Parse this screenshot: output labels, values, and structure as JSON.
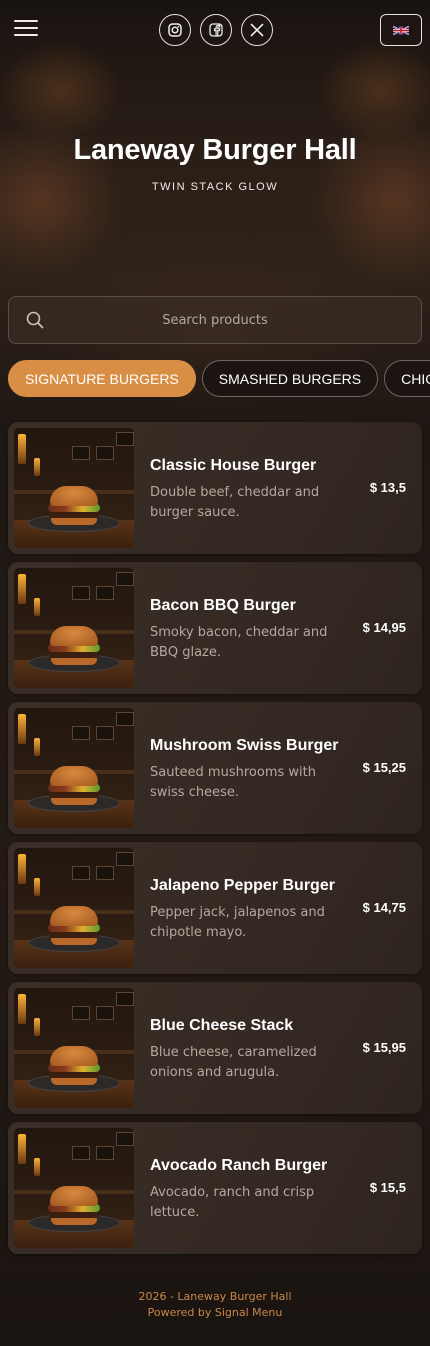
{
  "header": {
    "menu_icon": "hamburger-icon",
    "socials": [
      {
        "name": "instagram",
        "icon": "instagram-icon"
      },
      {
        "name": "facebook",
        "icon": "facebook-icon"
      },
      {
        "name": "x",
        "icon": "x-icon"
      }
    ],
    "language_icon": "uk-flag-icon"
  },
  "hero": {
    "title": "Laneway Burger Hall",
    "subtitle": "TWIN STACK GLOW"
  },
  "search": {
    "placeholder": "Search products",
    "value": ""
  },
  "categories": [
    {
      "label": "SIGNATURE BURGERS",
      "active": true
    },
    {
      "label": "SMASHED BURGERS",
      "active": false
    },
    {
      "label": "CHICKEN",
      "active": false
    }
  ],
  "items": [
    {
      "name": "Classic House Burger",
      "description": "Double beef, cheddar and burger sauce.",
      "price": "$ 13,5"
    },
    {
      "name": "Bacon BBQ Burger",
      "description": "Smoky bacon, cheddar and BBQ glaze.",
      "price": "$ 14,95"
    },
    {
      "name": "Mushroom Swiss Burger",
      "description": "Sauteed mushrooms with swiss cheese.",
      "price": "$ 15,25"
    },
    {
      "name": "Jalapeno Pepper Burger",
      "description": "Pepper jack, jalapenos and chipotle mayo.",
      "price": "$ 14,75"
    },
    {
      "name": "Blue Cheese Stack",
      "description": "Blue cheese, caramelized onions and arugula.",
      "price": "$ 15,95"
    },
    {
      "name": "Avocado Ranch Burger",
      "description": "Avocado, ranch and crisp lettuce.",
      "price": "$ 15,5"
    }
  ],
  "footer": {
    "line1": "2026 - Laneway Burger Hall",
    "line2": "Powered by Signal Menu"
  },
  "colors": {
    "accent": "#d88f45",
    "background": "#1f1713",
    "card": "#3a2e26",
    "footer_text": "#c8884a"
  }
}
